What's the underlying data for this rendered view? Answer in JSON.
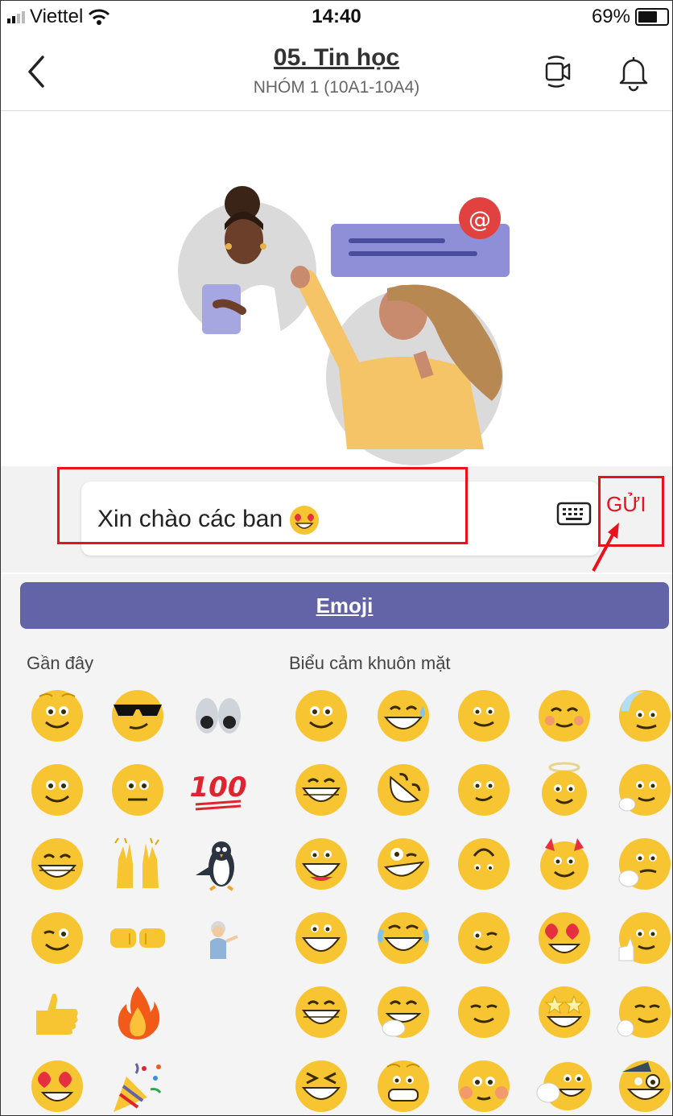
{
  "status_bar": {
    "carrier": "Viettel",
    "time": "14:40",
    "battery": "69%",
    "battery_level": 0.69
  },
  "header": {
    "title": "05. Tin học",
    "subtitle": "NHÓM 1 (10A1-10A4)"
  },
  "composer": {
    "message": "Xin chào các ban",
    "send_label": "GỬI"
  },
  "emoji_panel": {
    "tab_label": "Emoji",
    "recent_label": "Gần đây",
    "faces_label": "Biểu cảm khuôn mặt",
    "hundred_text": "100"
  },
  "colors": {
    "accent": "#6264a7",
    "annotation": "#e8111c",
    "emoji_yellow": "#f7c531"
  }
}
